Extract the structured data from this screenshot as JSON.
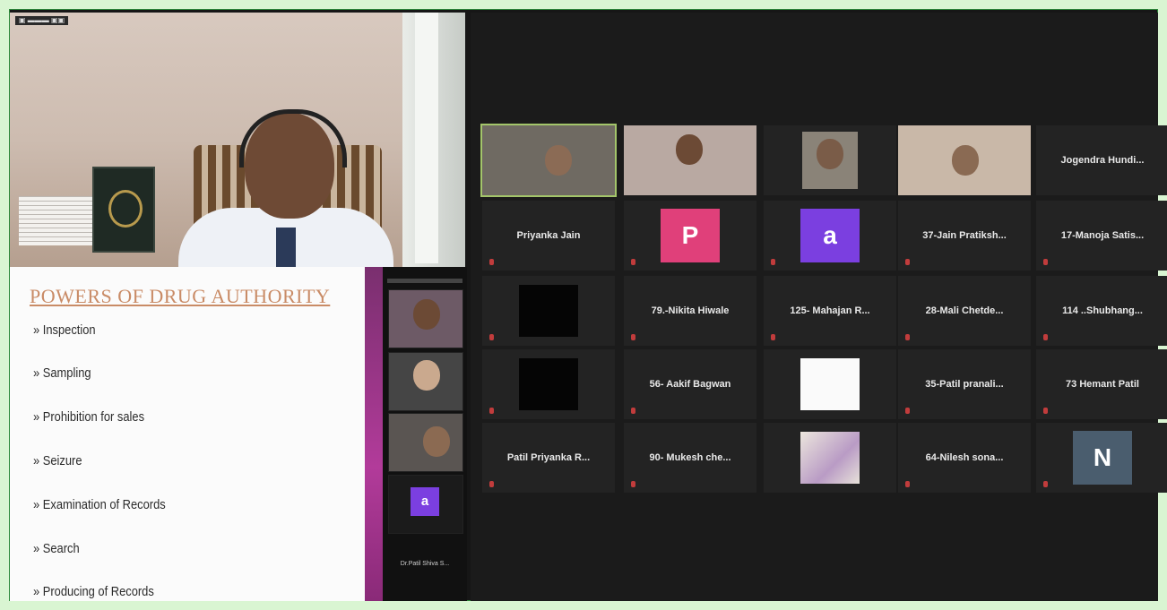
{
  "speaker": {
    "window_tag": ""
  },
  "slide": {
    "title": "POWERS OF DRUG AUTHORITY",
    "bullets": [
      "» Inspection",
      "» Sampling",
      "» Prohibition for sales",
      "» Seizure",
      "» Examination of Records",
      "» Search",
      "» Producing of Records"
    ]
  },
  "strip": {
    "avatar_letter": "a",
    "name_bottom": "Dr.Patil Shiva S..."
  },
  "gallery": {
    "row1": {
      "t5": "Jogendra Hundi..."
    },
    "row2": {
      "t1": "Priyanka Jain",
      "t2_avatar": "P",
      "t3_avatar": "a",
      "t4": "37-Jain  Pratiksh...",
      "t5": "17-Manoja  Satis..."
    },
    "row3": {
      "t2": "79.-Nikita Hiwale",
      "t3": "125-  Mahajan  R...",
      "t4": "28-Mali  Chetde...",
      "t5": "114  ..Shubhang..."
    },
    "row4": {
      "t2": "56-  Aakif Bagwan",
      "t4": "35-Patil  pranali...",
      "t5": "73 Hemant Patil"
    },
    "row5": {
      "t1": "Patil Priyanka R...",
      "t2": "90-  Mukesh  che...",
      "t4": "64-Nilesh  sona...",
      "t5_avatar": "N"
    }
  },
  "colors": {
    "frame_border": "#d9f5d2",
    "avatar_pink": "#e0407a",
    "avatar_purple": "#7b3fe0",
    "avatar_slate": "#4a5d6e",
    "active_speaker_outline": "#a3c56a",
    "slide_title": "#c98b66"
  }
}
